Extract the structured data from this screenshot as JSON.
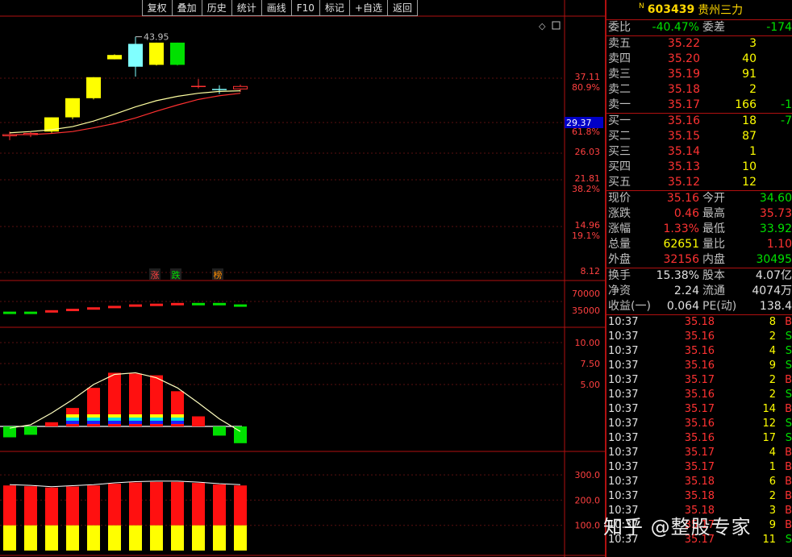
{
  "toolbar": [
    "复权",
    "叠加",
    "历史",
    "统计",
    "画线",
    "F10",
    "标记",
    "+自选",
    "返回"
  ],
  "stock": {
    "n_mark": "N",
    "code": "603439",
    "name": "贵州三力"
  },
  "weibi": {
    "label": "委比",
    "value": "-40.47%",
    "diff_label": "委差",
    "diff_value": "-174"
  },
  "asks": [
    {
      "label": "卖五",
      "price": "35.22",
      "vol": "3",
      "chg": ""
    },
    {
      "label": "卖四",
      "price": "35.20",
      "vol": "40",
      "chg": ""
    },
    {
      "label": "卖三",
      "price": "35.19",
      "vol": "91",
      "chg": ""
    },
    {
      "label": "卖二",
      "price": "35.18",
      "vol": "2",
      "chg": ""
    },
    {
      "label": "卖一",
      "price": "35.17",
      "vol": "166",
      "chg": "-1"
    }
  ],
  "bids": [
    {
      "label": "买一",
      "price": "35.16",
      "vol": "18",
      "chg": "-7"
    },
    {
      "label": "买二",
      "price": "35.15",
      "vol": "87",
      "chg": ""
    },
    {
      "label": "买三",
      "price": "35.14",
      "vol": "1",
      "chg": ""
    },
    {
      "label": "买四",
      "price": "35.13",
      "vol": "10",
      "chg": ""
    },
    {
      "label": "买五",
      "price": "35.12",
      "vol": "12",
      "chg": ""
    }
  ],
  "stats": [
    {
      "l1": "现价",
      "v1": "35.16",
      "c1": "red",
      "l2": "今开",
      "v2": "34.60",
      "c2": "green"
    },
    {
      "l1": "涨跌",
      "v1": "0.46",
      "c1": "red",
      "l2": "最高",
      "v2": "35.73",
      "c2": "red"
    },
    {
      "l1": "涨幅",
      "v1": "1.33%",
      "c1": "red",
      "l2": "最低",
      "v2": "33.92",
      "c2": "green"
    },
    {
      "l1": "总量",
      "v1": "62651",
      "c1": "yellow",
      "l2": "量比",
      "v2": "1.10",
      "c2": "red"
    },
    {
      "l1": "外盘",
      "v1": "32156",
      "c1": "red",
      "l2": "内盘",
      "v2": "30495",
      "c2": "green"
    }
  ],
  "stats2": [
    {
      "l1": "换手",
      "v1": "15.38%",
      "l2": "股本",
      "v2": "4.07亿"
    },
    {
      "l1": "净资",
      "v1": "2.24",
      "l2": "流通",
      "v2": "4074万"
    },
    {
      "l1": "收益(一)",
      "v1": "0.064",
      "l2": "PE(动)",
      "v2": "138.4"
    }
  ],
  "ticks": [
    {
      "time": "10:37",
      "price": "35.18",
      "pc": "red",
      "vol": "8",
      "bs": "B"
    },
    {
      "time": "10:37",
      "price": "35.16",
      "pc": "red",
      "vol": "2",
      "bs": "S"
    },
    {
      "time": "10:37",
      "price": "35.16",
      "pc": "red",
      "vol": "4",
      "bs": "S"
    },
    {
      "time": "10:37",
      "price": "35.16",
      "pc": "red",
      "vol": "9",
      "bs": "S"
    },
    {
      "time": "10:37",
      "price": "35.17",
      "pc": "red",
      "vol": "2",
      "bs": "B"
    },
    {
      "time": "10:37",
      "price": "35.16",
      "pc": "red",
      "vol": "2",
      "bs": "S"
    },
    {
      "time": "10:37",
      "price": "35.17",
      "pc": "red",
      "vol": "14",
      "bs": "B"
    },
    {
      "time": "10:37",
      "price": "35.16",
      "pc": "red",
      "vol": "12",
      "bs": "S"
    },
    {
      "time": "10:37",
      "price": "35.16",
      "pc": "red",
      "vol": "17",
      "bs": "S"
    },
    {
      "time": "10:37",
      "price": "35.17",
      "pc": "red",
      "vol": "4",
      "bs": "B"
    },
    {
      "time": "10:37",
      "price": "35.17",
      "pc": "red",
      "vol": "1",
      "bs": "B"
    },
    {
      "time": "10:37",
      "price": "35.18",
      "pc": "red",
      "vol": "6",
      "bs": "B"
    },
    {
      "time": "10:37",
      "price": "35.18",
      "pc": "red",
      "vol": "2",
      "bs": "B"
    },
    {
      "time": "10:37",
      "price": "35.18",
      "pc": "red",
      "vol": "3",
      "bs": "B"
    },
    {
      "time": "10:37",
      "price": "35.17",
      "pc": "red",
      "vol": "9",
      "bs": "B"
    },
    {
      "time": "10:37",
      "price": "35.17",
      "pc": "red",
      "vol": "11",
      "bs": "S"
    }
  ],
  "price_axis": [
    {
      "value": "37.11",
      "pct": "80.9%"
    },
    {
      "value": "29.37",
      "pct": "61.8%",
      "highlight": true
    },
    {
      "value": "26.03",
      "pct": ""
    },
    {
      "value": "21.81",
      "pct": "38.2%"
    },
    {
      "value": "14.96",
      "pct": "19.1%"
    },
    {
      "value": "8.12",
      "pct": ""
    }
  ],
  "high_label": "43.95",
  "markers": [
    {
      "text": "涨",
      "color": "#ff4040"
    },
    {
      "text": "跌",
      "color": "#00e000"
    },
    {
      "text": "榜",
      "color": "#ff8c00"
    }
  ],
  "strip_axis": [
    "70000",
    "35000"
  ],
  "macd_axis": [
    "10.00",
    "7.50",
    "5.00"
  ],
  "vol_axis": [
    "300.0",
    "200.0",
    "100.0"
  ],
  "chart_data": {
    "type": "candlestick",
    "candles": [
      {
        "o": 28.0,
        "h": 28.6,
        "l": 27.2,
        "c": 28.1
      },
      {
        "o": 28.1,
        "h": 28.5,
        "l": 27.7,
        "c": 28.3
      },
      {
        "o": 28.6,
        "h": 30.9,
        "l": 28.4,
        "c": 30.9
      },
      {
        "o": 30.9,
        "h": 34.0,
        "l": 30.6,
        "c": 34.0
      },
      {
        "o": 34.0,
        "h": 37.4,
        "l": 33.8,
        "c": 37.4
      },
      {
        "o": 41.0,
        "h": 41.1,
        "l": 40.3,
        "c": 40.3
      },
      {
        "o": 39.1,
        "h": 43.95,
        "l": 37.5,
        "c": 42.8
      },
      {
        "o": 39.4,
        "h": 43.0,
        "l": 39.3,
        "c": 43.0
      },
      {
        "o": 39.4,
        "h": 43.0,
        "l": 39.3,
        "c": 43.0
      },
      {
        "o": 36.0,
        "h": 37.1,
        "l": 35.6,
        "c": 36.0
      },
      {
        "o": 35.5,
        "h": 36.1,
        "l": 34.7,
        "c": 35.5
      },
      {
        "o": 35.5,
        "h": 36.2,
        "l": 35.0,
        "c": 35.9
      }
    ],
    "ma_short": [
      28.4,
      28.6,
      28.9,
      29.4,
      30.3,
      31.4,
      32.6,
      33.6,
      34.3,
      34.8,
      35.1,
      35.2
    ],
    "ma_long": [
      28.1,
      28.1,
      28.3,
      28.6,
      29.2,
      29.9,
      30.8,
      31.9,
      32.9,
      33.8,
      34.4,
      34.8
    ],
    "strip": [
      {
        "v": 0.3,
        "c": "#00e000"
      },
      {
        "v": 0.3,
        "c": "#00e000"
      },
      {
        "v": 0.4,
        "c": "#ff2020"
      },
      {
        "v": 0.5,
        "c": "#ff2020"
      },
      {
        "v": 0.6,
        "c": "#ff2020"
      },
      {
        "v": 0.7,
        "c": "#ff2020"
      },
      {
        "v": 0.8,
        "c": "#ff2020"
      },
      {
        "v": 0.85,
        "c": "#ff2020"
      },
      {
        "v": 0.9,
        "c": "#ff2020"
      },
      {
        "v": 0.9,
        "c": "#00e000"
      },
      {
        "v": 0.9,
        "c": "#00e000"
      },
      {
        "v": 0.8,
        "c": "#00e000"
      }
    ],
    "macd": [
      -1.3,
      -1.0,
      0.5,
      2.2,
      4.6,
      6.4,
      6.3,
      6.1,
      4.2,
      1.2,
      -1.1,
      -2.0
    ],
    "macd_line": [
      -0.2,
      0.2,
      1.6,
      3.2,
      5.0,
      6.2,
      6.4,
      5.8,
      4.6,
      2.8,
      0.9,
      -0.6
    ],
    "vol_total": [
      258,
      255,
      250,
      254,
      258,
      265,
      270,
      272,
      272,
      268,
      262,
      258
    ],
    "vol_yellow": [
      100,
      100,
      100,
      100,
      100,
      100,
      100,
      100,
      100,
      100,
      100,
      100
    ]
  },
  "watermark": "知乎 @整股专家"
}
